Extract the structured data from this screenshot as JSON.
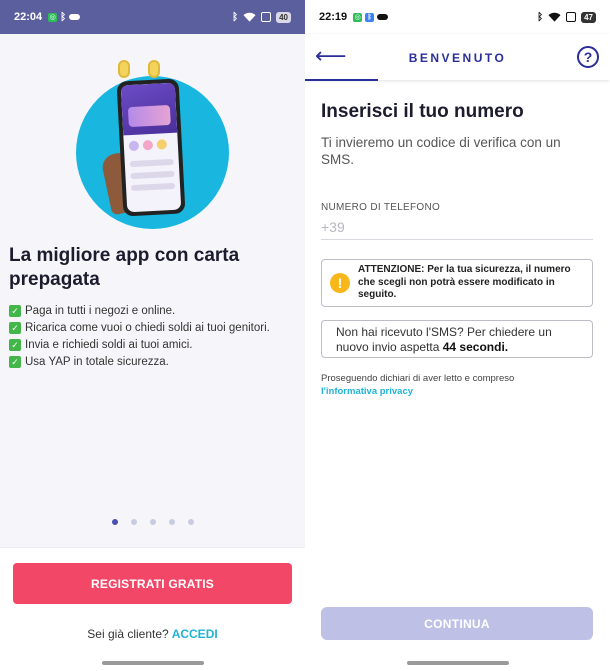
{
  "left": {
    "statusbar": {
      "time": "22:04",
      "battery": "40"
    },
    "title": "La migliore app con carta prepagata",
    "features": [
      "Paga in tutti i negozi e online.",
      "Ricarica come vuoi o chiedi soldi ai tuoi genitori.",
      "Invia e richiedi soldi ai tuoi amici.",
      "Usa YAP in totale sicurezza."
    ],
    "pager": {
      "count": 5,
      "active": 0
    },
    "register_button": "REGISTRATI GRATIS",
    "login_prompt": "Sei già cliente?",
    "login_link": "ACCEDI"
  },
  "right": {
    "statusbar": {
      "time": "22:19",
      "battery": "47"
    },
    "appbar_title": "BENVENUTO",
    "heading": "Inserisci il tuo numero",
    "subtitle": "Ti invieremo un codice di verifica con un SMS.",
    "phone_label": "NUMERO DI TELEFONO",
    "phone_placeholder": "+39",
    "warning": "ATTENZIONE: Per la tua sicurezza, il numero che scegli non potrà essere modificato in seguito.",
    "sms_text": "Non hai ricevuto l'SMS? Per chiedere un nuovo invio aspetta",
    "sms_countdown": "44 secondi.",
    "privacy_text": "Proseguendo dichiari di aver letto e compreso",
    "privacy_link": "l'informativa privacy",
    "continue_button": "CONTINUA"
  },
  "colors": {
    "brand_indigo": "#2a2e9a",
    "accent_pink": "#f24767",
    "link_cyan": "#20b3d8",
    "warning_yellow": "#f7b71a",
    "disabled_button": "#bfc0e6"
  }
}
